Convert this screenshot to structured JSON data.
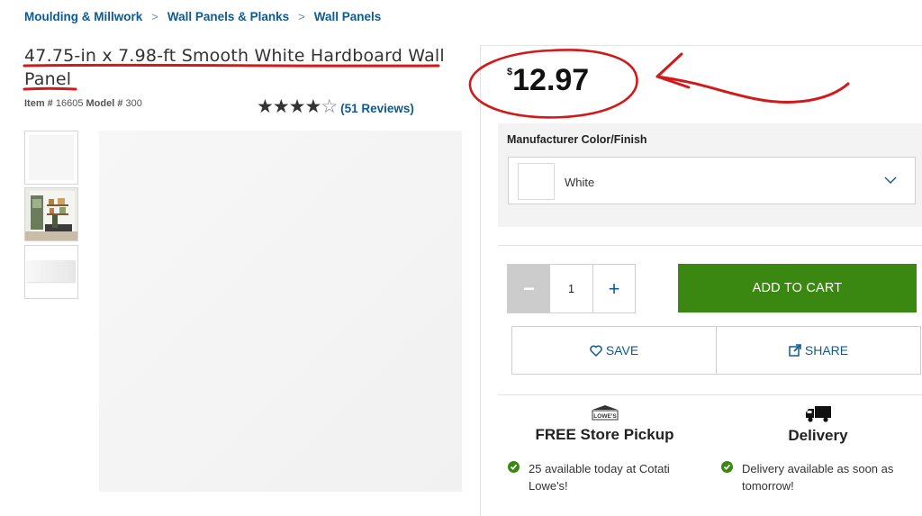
{
  "breadcrumb": [
    "Moulding & Millwork",
    "Wall Panels & Planks",
    "Wall Panels"
  ],
  "product": {
    "title": "47.75-in x 7.98-ft Smooth White Hardboard Wall Panel",
    "item_label": "Item #",
    "item_number": "16605",
    "model_label": "Model #",
    "model_number": "300",
    "rating": 4,
    "rating_max": 5,
    "reviews_text": "(51 Reviews)"
  },
  "price": {
    "currency": "$",
    "amount": "12.97"
  },
  "finish": {
    "label": "Manufacturer Color/Finish",
    "value": "White"
  },
  "quantity": {
    "value": "1",
    "minus": "−",
    "plus": "+"
  },
  "actions": {
    "add_to_cart": "ADD TO CART",
    "save": "SAVE",
    "share": "SHARE"
  },
  "pickup": {
    "title": "FREE Store Pickup",
    "availability": "25 available today at Cotati Lowe's!",
    "icon": "lowes-store-icon",
    "logo_text": "LOWE'S"
  },
  "delivery": {
    "title": "Delivery",
    "availability": "Delivery available as soon as tomorrow!",
    "icon": "truck-icon"
  },
  "colors": {
    "link": "#0f5a91",
    "cart": "#3a8712",
    "annotation": "#d11a1a"
  }
}
